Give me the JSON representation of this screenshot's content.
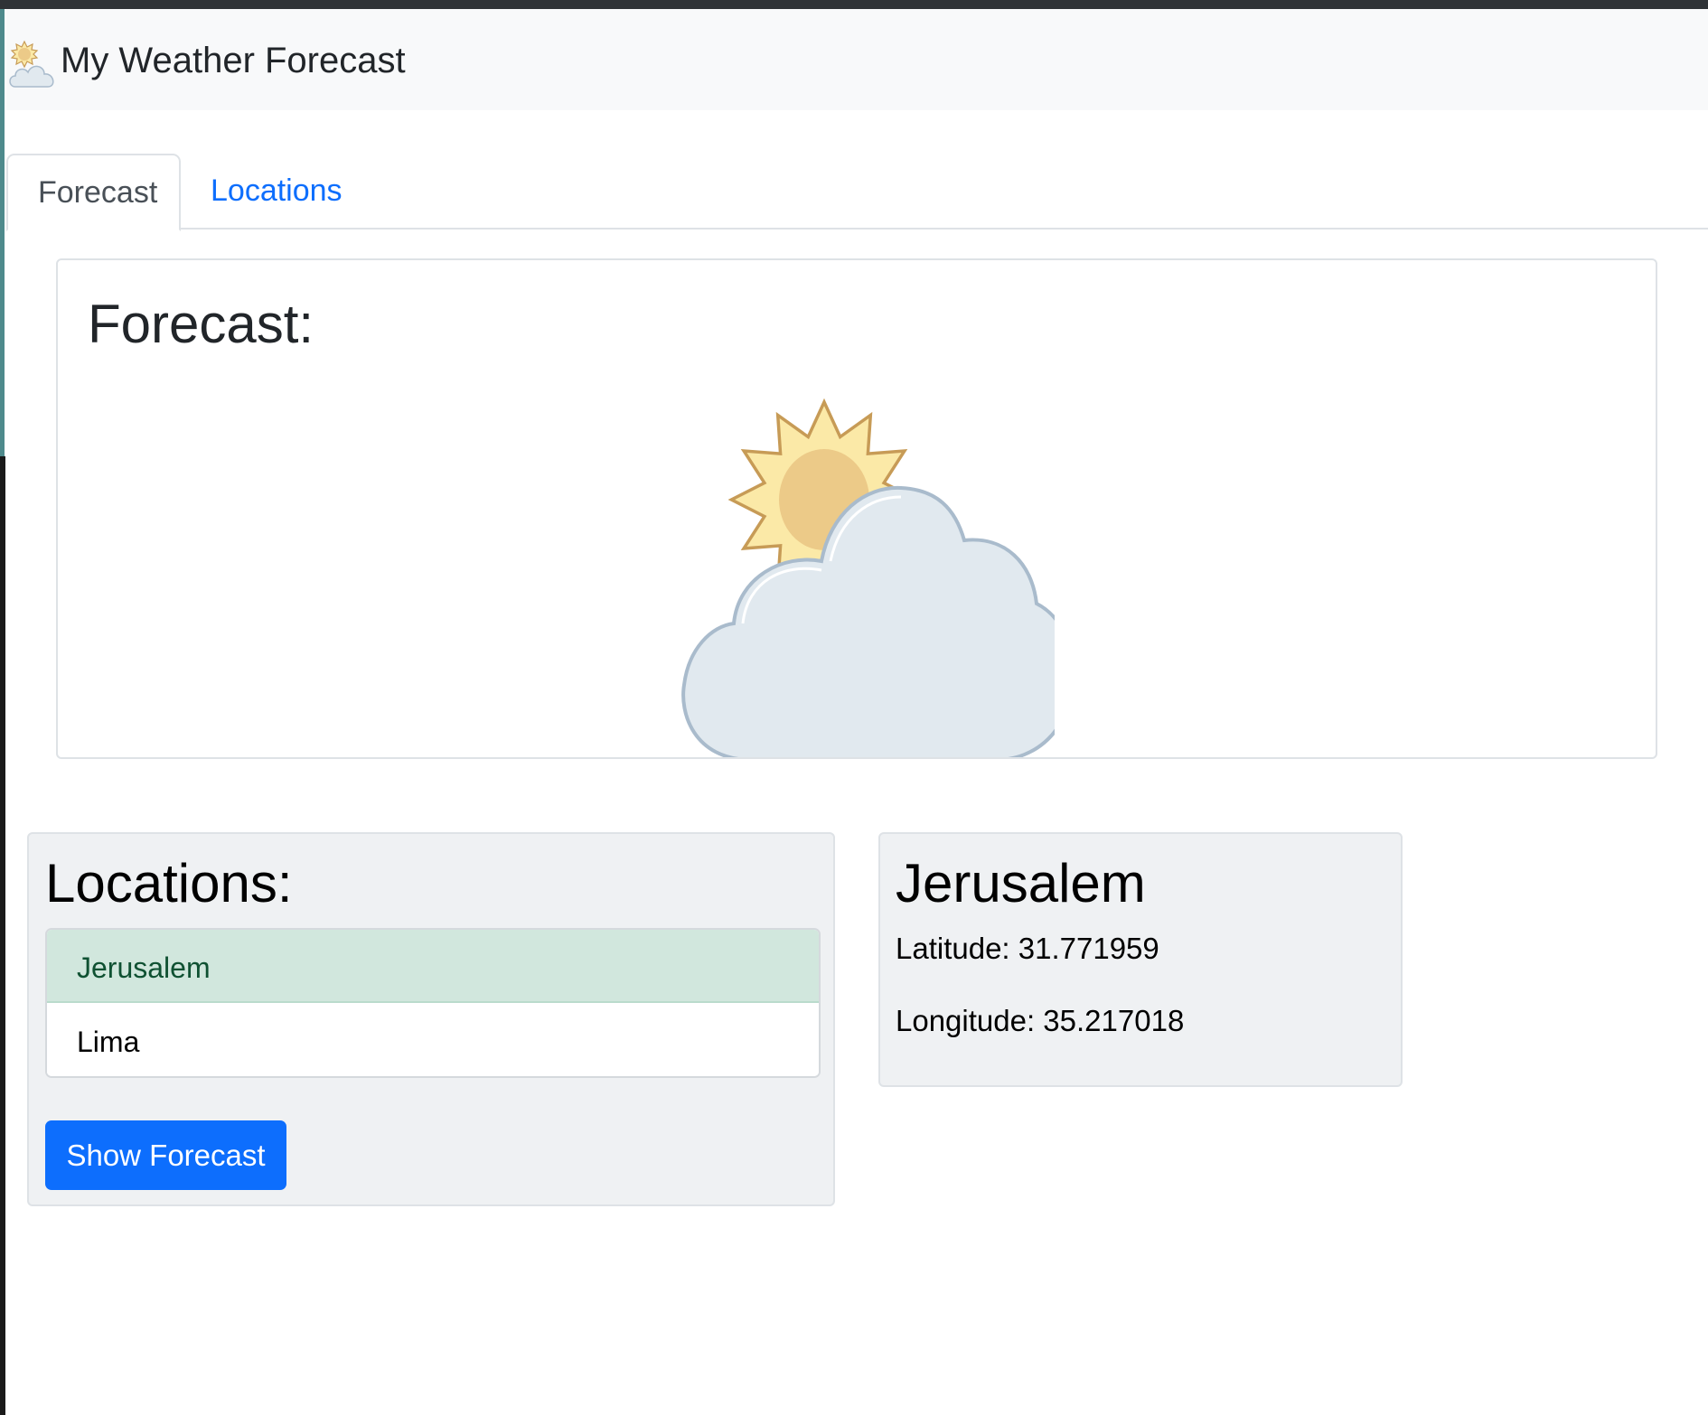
{
  "navbar": {
    "title": "My Weather Forecast",
    "icon": "partly-cloudy-icon"
  },
  "tabs": [
    {
      "label": "Forecast",
      "active": true
    },
    {
      "label": "Locations",
      "active": false
    }
  ],
  "forecast": {
    "heading": "Forecast:",
    "icon": "partly-cloudy-icon"
  },
  "locations": {
    "heading": "Locations:",
    "items": [
      {
        "label": "Jerusalem",
        "selected": true
      },
      {
        "label": "Lima",
        "selected": false
      }
    ],
    "button_label": "Show Forecast"
  },
  "details": {
    "name": "Jerusalem",
    "latitude": "Latitude: 31.771959",
    "longitude": "Longitude: 35.217018"
  },
  "colors": {
    "primary": "#0d6efd",
    "selected_bg": "#d1e7dd",
    "selected_text": "#0f5132",
    "card_bg": "#eff1f3",
    "navbar_bg": "#f8f9fa",
    "sun_fill": "#fbe9a7",
    "sun_core": "#ecca88",
    "sun_stroke": "#c79b56",
    "cloud_fill": "#e1e9ef",
    "cloud_stroke": "#a9bbcc"
  }
}
